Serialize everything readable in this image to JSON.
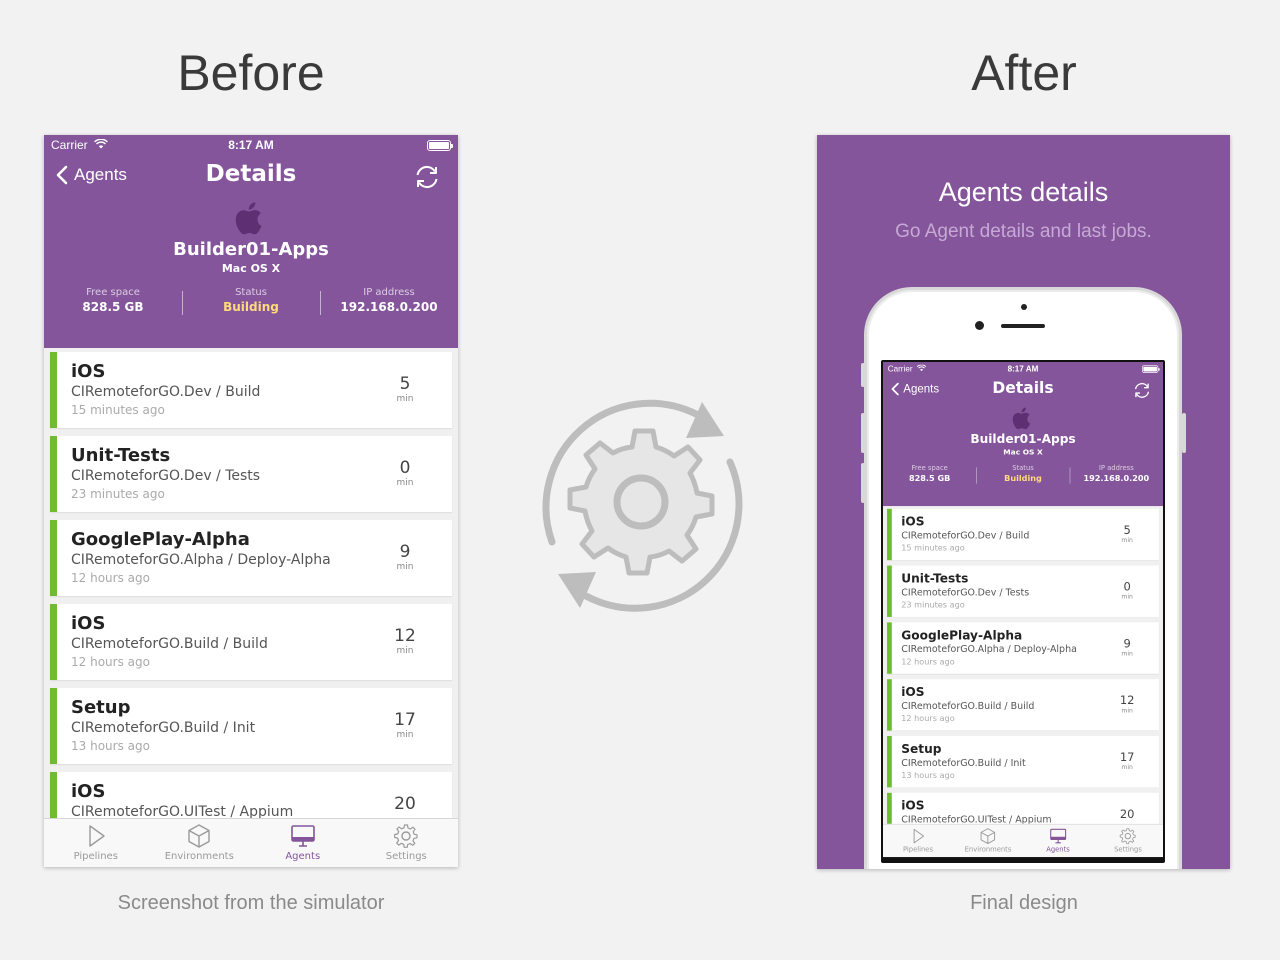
{
  "before": {
    "heading": "Before",
    "caption": "Screenshot from the simulator"
  },
  "after": {
    "heading": "After",
    "caption": "Final design",
    "title": "Agents details",
    "subtitle": "Go Agent details and last jobs."
  },
  "app": {
    "statusbar": {
      "carrier": "Carrier",
      "time": "8:17 AM"
    },
    "nav": {
      "back_label": "Agents",
      "title": "Details"
    },
    "agent": {
      "name": "Builder01-Apps",
      "os": "Mac OS X",
      "stats": [
        {
          "label": "Free space",
          "value": "828.5 GB"
        },
        {
          "label": "Status",
          "value": "Building"
        },
        {
          "label": "IP address",
          "value": "192.168.0.200"
        }
      ]
    },
    "jobs": [
      {
        "name": "iOS",
        "pipeline": "CIRemoteforGO.Dev / Build",
        "time": "15 minutes ago",
        "duration": "5",
        "unit": "min"
      },
      {
        "name": "Unit-Tests",
        "pipeline": "CIRemoteforGO.Dev / Tests",
        "time": "23 minutes ago",
        "duration": "0",
        "unit": "min"
      },
      {
        "name": "GooglePlay-Alpha",
        "pipeline": "CIRemoteforGO.Alpha / Deploy-Alpha",
        "time": "12 hours ago",
        "duration": "9",
        "unit": "min"
      },
      {
        "name": "iOS",
        "pipeline": "CIRemoteforGO.Build / Build",
        "time": "12 hours ago",
        "duration": "12",
        "unit": "min"
      },
      {
        "name": "Setup",
        "pipeline": "CIRemoteforGO.Build / Init",
        "time": "13 hours ago",
        "duration": "17",
        "unit": "min"
      },
      {
        "name": "iOS",
        "pipeline": "CIRemoteforGO.UITest / Appium",
        "time": "",
        "duration": "20",
        "unit": ""
      }
    ],
    "tabs": [
      {
        "label": "Pipelines",
        "icon": "play-icon"
      },
      {
        "label": "Environments",
        "icon": "cube-icon"
      },
      {
        "label": "Agents",
        "icon": "monitor-icon",
        "active": true
      },
      {
        "label": "Settings",
        "icon": "gear-icon"
      }
    ]
  },
  "colors": {
    "brand_purple": "#84559b",
    "success_green": "#6ebd2f",
    "building_yellow": "#ffd97a"
  }
}
